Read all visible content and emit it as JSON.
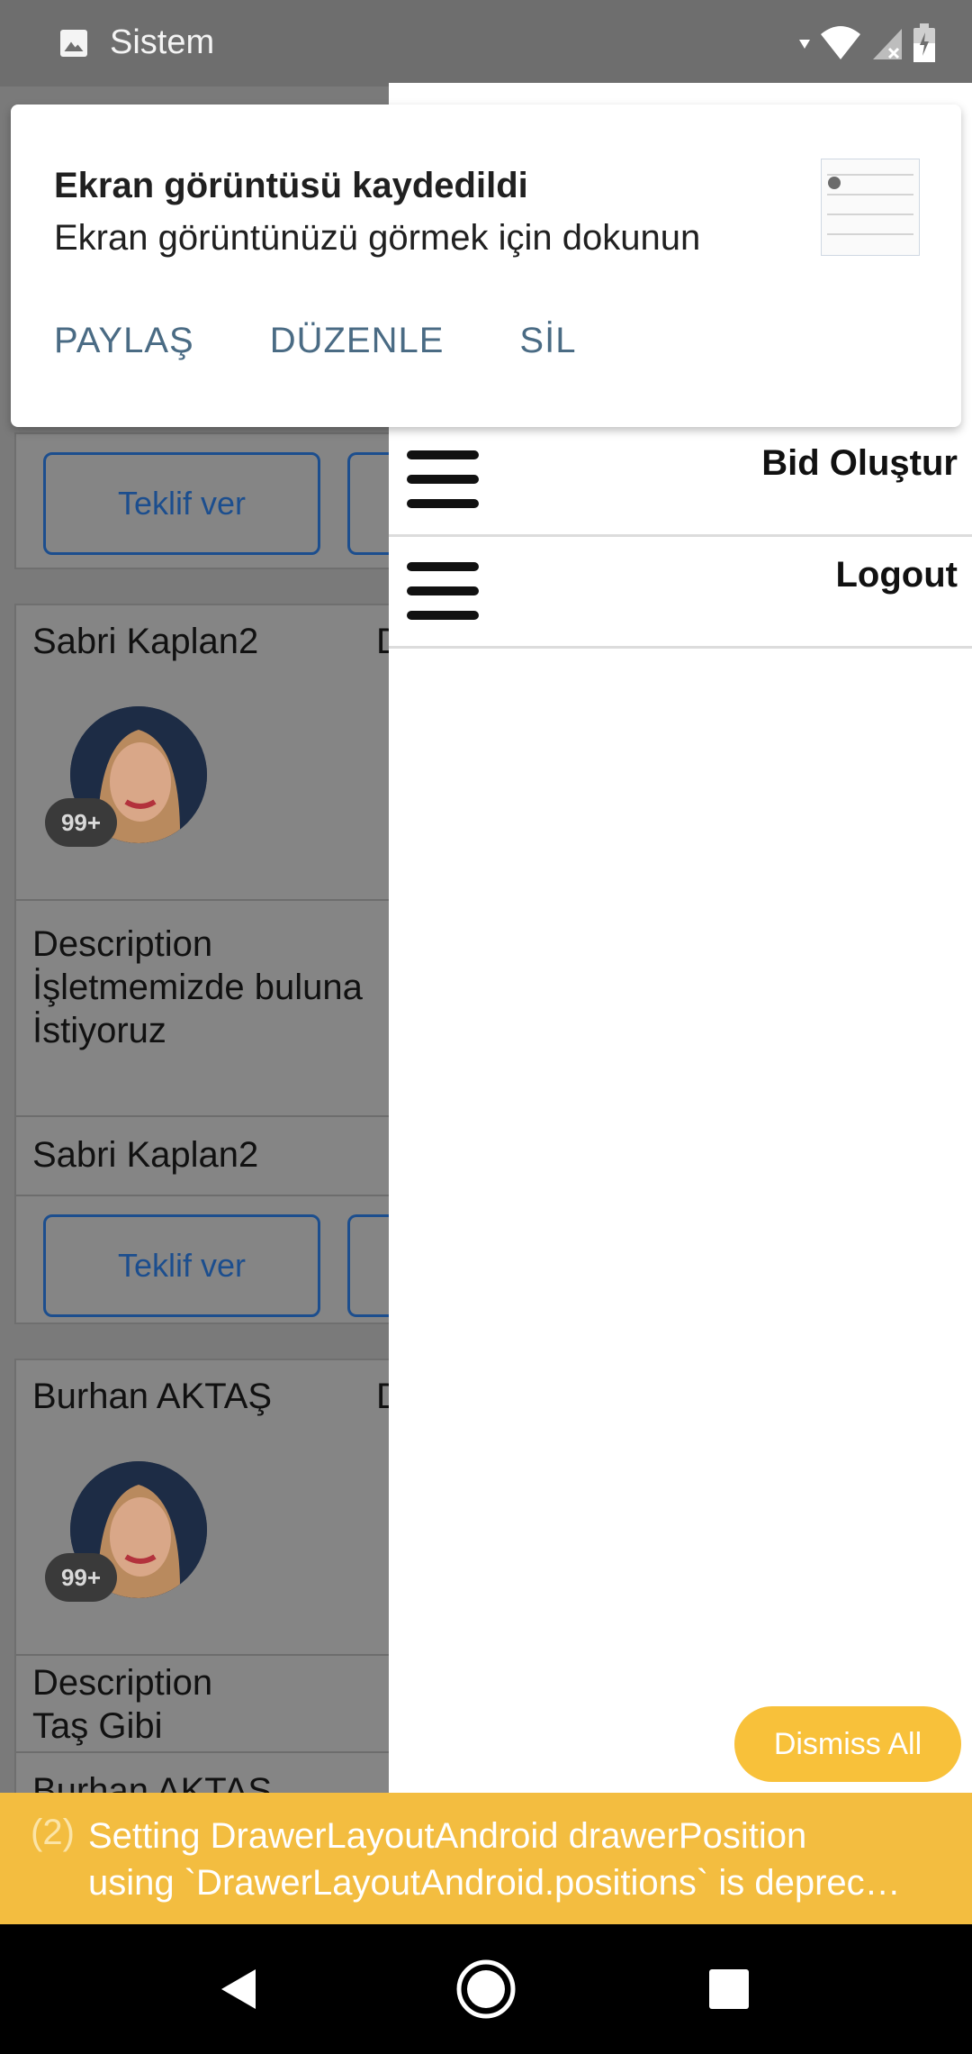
{
  "status_bar": {
    "label": "Sistem",
    "icons": [
      "image-icon",
      "wifi-icon",
      "signal-icon",
      "battery-icon"
    ]
  },
  "notification": {
    "title": "Ekran görüntüsü kaydedildi",
    "text": "Ekran görüntünüzü görmek için dokunun",
    "actions": {
      "share": "PAYLAŞ",
      "edit": "DÜZENLE",
      "delete": "SİL"
    }
  },
  "drawer": {
    "items": [
      {
        "label": "Bid Oluştur",
        "icon": "menu-icon"
      },
      {
        "label": "Logout",
        "icon": "menu-icon"
      }
    ]
  },
  "list": {
    "cards": [
      {
        "bid_button": "Teklif ver"
      },
      {
        "name": "Sabri Kaplan2",
        "date_trunc": "D",
        "badge": "99+",
        "description": "Description\nİşletmemizde buluna\nİstiyoruz",
        "owner": "Sabri Kaplan2",
        "bid_button": "Teklif ver"
      },
      {
        "name": "Burhan AKTAŞ",
        "date_trunc": "D",
        "badge": "99+",
        "description": "Description\nTaş Gibi",
        "owner": "Burhan AKTAŞ"
      }
    ]
  },
  "dismiss_all": "Dismiss All",
  "warning": {
    "count": "(2)",
    "message": "Setting DrawerLayoutAndroid drawerPosition\nusing `DrawerLayoutAndroid.positions` is deprec…"
  },
  "colors": {
    "accent_yellow": "#f3bd40",
    "button_blue": "#1c4e8e",
    "action_blue_grey": "#4a6b84"
  }
}
